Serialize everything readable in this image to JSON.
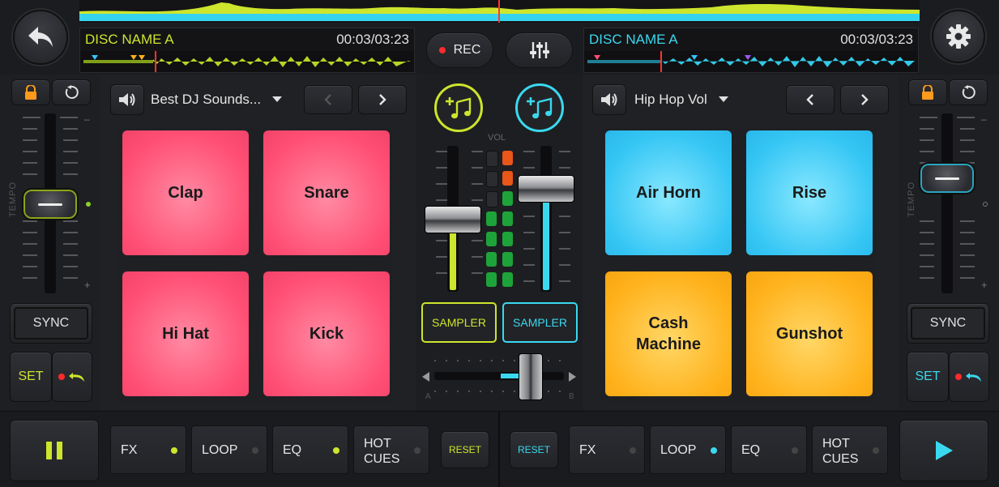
{
  "deck_a": {
    "disc_name": "DISC NAME A",
    "time": "00:03/03:23",
    "library": "Best DJ Sounds...",
    "pads": [
      "Clap",
      "Snare",
      "Hi Hat",
      "Kick"
    ],
    "sync": "SYNC",
    "set": "SET",
    "tempo": "TEMPO",
    "minus": "–",
    "plus": "+",
    "sampler": "SAMPLER",
    "fx_tabs": [
      {
        "label": "FX",
        "active": true
      },
      {
        "label": "LOOP",
        "active": false
      },
      {
        "label": "EQ",
        "active": true
      },
      {
        "label": "HOT\nCUES",
        "active": false
      }
    ],
    "reset": "RESET"
  },
  "deck_b": {
    "disc_name": "DISC NAME A",
    "time": "00:03/03:23",
    "library": "Hip Hop Vol",
    "pads": [
      "Air Horn",
      "Rise",
      "Cash\nMachine",
      "Gunshot"
    ],
    "sync": "SYNC",
    "set": "SET",
    "tempo": "TEMPO",
    "minus": "–",
    "plus": "+",
    "sampler": "SAMPLER",
    "fx_tabs": [
      {
        "label": "FX",
        "active": false
      },
      {
        "label": "LOOP",
        "active": true
      },
      {
        "label": "EQ",
        "active": false
      },
      {
        "label": "HOT\nCUES",
        "active": false
      }
    ],
    "reset": "RESET"
  },
  "mixer": {
    "rec": "REC",
    "vol": "VOL",
    "cross_a": "A",
    "cross_b": "B"
  },
  "colors": {
    "deck_a_accent": "#cde52c",
    "deck_b_accent": "#3ad8ef",
    "pink_pad": "#ff4f74",
    "blue_pad": "#35c6f4",
    "orange_pad": "#ffb21c"
  },
  "icons": {
    "back": "back-arrow-icon",
    "settings": "gear-icon",
    "mixer": "sliders-icon",
    "lock": "lock-icon",
    "reset": "reset-icon",
    "speaker": "speaker-icon",
    "add_music": "add-music-icon",
    "play": "play-icon",
    "pause": "pause-icon"
  }
}
